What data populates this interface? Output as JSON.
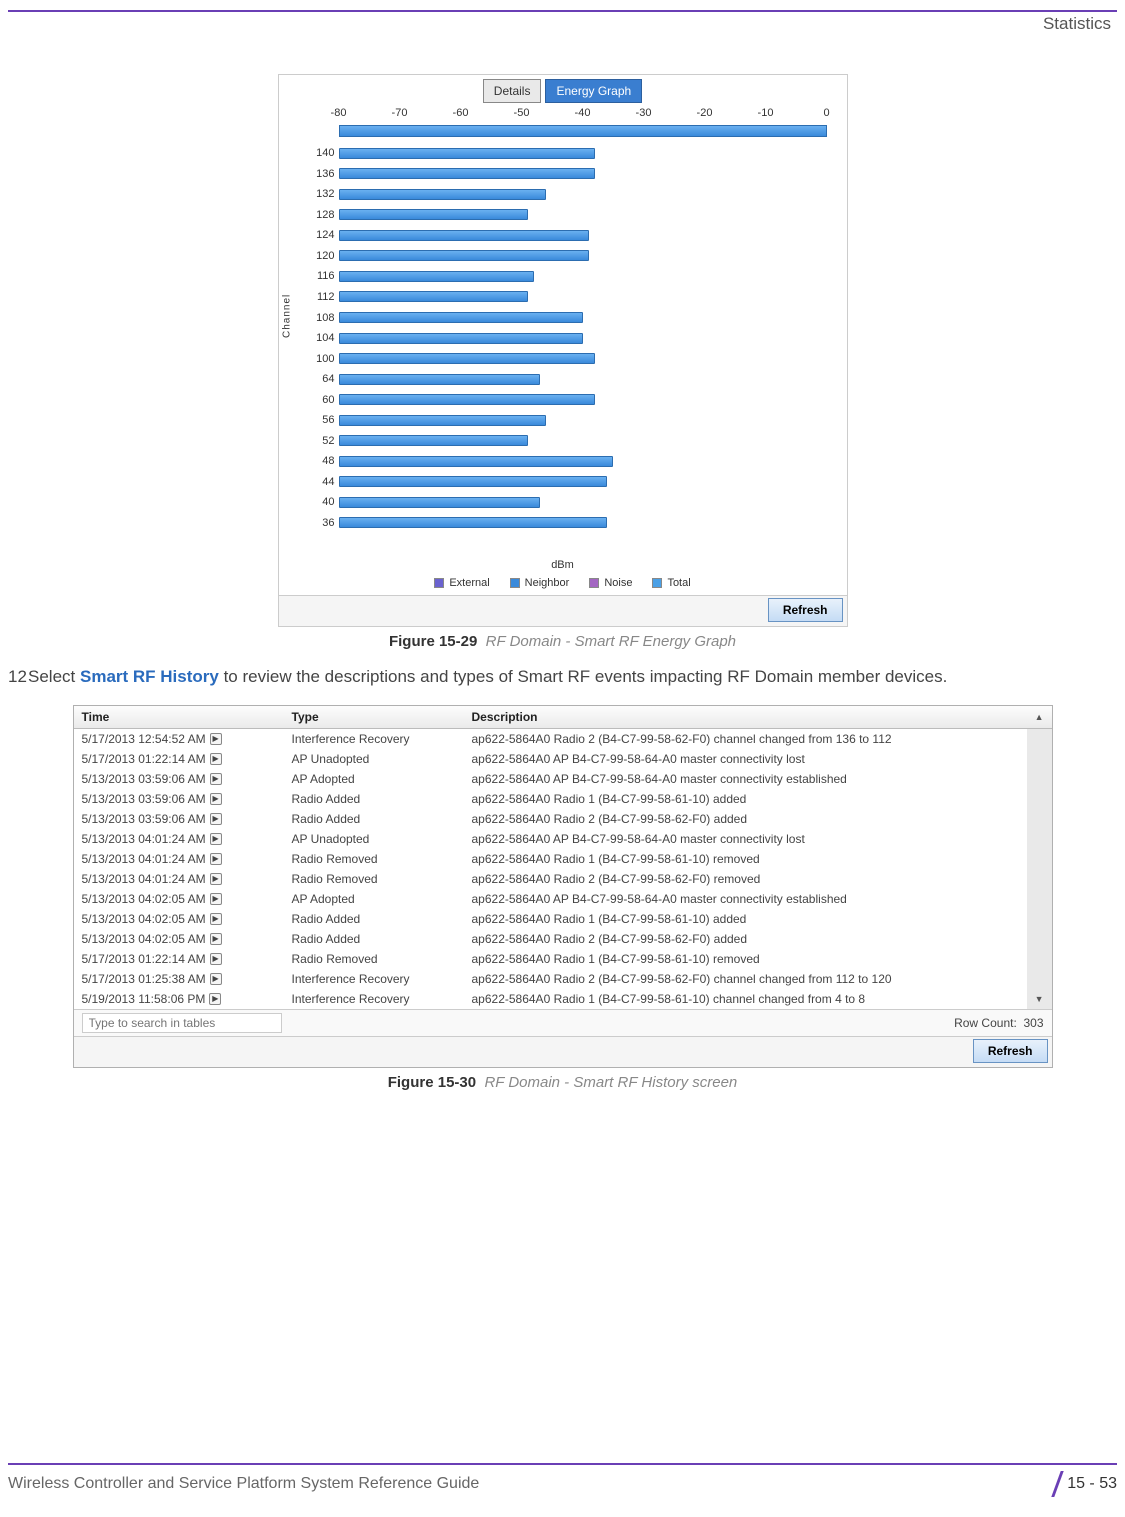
{
  "header": {
    "section": "Statistics"
  },
  "chart": {
    "tabs": {
      "details": "Details",
      "energy": "Energy Graph"
    },
    "xlabel": "dBm",
    "ylabel": "Channel",
    "legend": [
      "External",
      "Neighbor",
      "Noise",
      "Total"
    ],
    "refresh": "Refresh"
  },
  "chart_data": {
    "type": "bar",
    "title": "",
    "xlabel": "dBm",
    "ylabel": "Channel",
    "xlim": [
      -80,
      0
    ],
    "x_ticks": [
      -80,
      -70,
      -60,
      -50,
      -40,
      -30,
      -20,
      -10,
      0
    ],
    "categories": [
      "140",
      "136",
      "132",
      "128",
      "124",
      "120",
      "116",
      "112",
      "108",
      "104",
      "100",
      "64",
      "60",
      "56",
      "52",
      "48",
      "44",
      "40",
      "36"
    ],
    "values": [
      -38,
      -38,
      -46,
      -49,
      -39,
      -39,
      -48,
      -49,
      -40,
      -40,
      -38,
      -47,
      -38,
      -46,
      -49,
      -35,
      -36,
      -47,
      -36
    ],
    "legend": [
      "External",
      "Neighbor",
      "Noise",
      "Total"
    ]
  },
  "fig29": {
    "label": "Figure 15-29",
    "caption": "RF Domain - Smart RF Energy Graph"
  },
  "step": {
    "num": "12",
    "pre": "Select ",
    "bold": "Smart RF History",
    "post": " to review the descriptions and types of Smart RF events impacting RF Domain member devices."
  },
  "table": {
    "headers": {
      "time": "Time",
      "type": "Type",
      "desc": "Description"
    },
    "rows": [
      {
        "time": "5/17/2013 12:54:52 AM",
        "type": "Interference Recovery",
        "desc": "ap622-5864A0 Radio 2 (B4-C7-99-58-62-F0) channel changed from 136 to 112"
      },
      {
        "time": "5/17/2013 01:22:14 AM",
        "type": "AP Unadopted",
        "desc": "ap622-5864A0 AP B4-C7-99-58-64-A0 master connectivity lost"
      },
      {
        "time": "5/13/2013 03:59:06 AM",
        "type": "AP Adopted",
        "desc": "ap622-5864A0 AP B4-C7-99-58-64-A0 master connectivity established"
      },
      {
        "time": "5/13/2013 03:59:06 AM",
        "type": "Radio Added",
        "desc": "ap622-5864A0 Radio 1 (B4-C7-99-58-61-10) added"
      },
      {
        "time": "5/13/2013 03:59:06 AM",
        "type": "Radio Added",
        "desc": "ap622-5864A0 Radio 2 (B4-C7-99-58-62-F0) added"
      },
      {
        "time": "5/13/2013 04:01:24 AM",
        "type": "AP Unadopted",
        "desc": "ap622-5864A0 AP B4-C7-99-58-64-A0 master connectivity lost"
      },
      {
        "time": "5/13/2013 04:01:24 AM",
        "type": "Radio Removed",
        "desc": "ap622-5864A0 Radio 1 (B4-C7-99-58-61-10) removed"
      },
      {
        "time": "5/13/2013 04:01:24 AM",
        "type": "Radio Removed",
        "desc": "ap622-5864A0 Radio 2 (B4-C7-99-58-62-F0) removed"
      },
      {
        "time": "5/13/2013 04:02:05 AM",
        "type": "AP Adopted",
        "desc": "ap622-5864A0 AP B4-C7-99-58-64-A0 master connectivity established"
      },
      {
        "time": "5/13/2013 04:02:05 AM",
        "type": "Radio Added",
        "desc": "ap622-5864A0 Radio 1 (B4-C7-99-58-61-10) added"
      },
      {
        "time": "5/13/2013 04:02:05 AM",
        "type": "Radio Added",
        "desc": "ap622-5864A0 Radio 2 (B4-C7-99-58-62-F0) added"
      },
      {
        "time": "5/17/2013 01:22:14 AM",
        "type": "Radio Removed",
        "desc": "ap622-5864A0 Radio 1 (B4-C7-99-58-61-10) removed"
      },
      {
        "time": "5/17/2013 01:25:38 AM",
        "type": "Interference Recovery",
        "desc": "ap622-5864A0 Radio 2 (B4-C7-99-58-62-F0) channel changed from 112 to 120"
      },
      {
        "time": "5/19/2013 11:58:06 PM",
        "type": "Interference Recovery",
        "desc": "ap622-5864A0 Radio 1 (B4-C7-99-58-61-10) channel changed from 4 to 8"
      }
    ],
    "filter_placeholder": "Type to search in tables",
    "rowcount_label": "Row Count:",
    "rowcount": "303",
    "refresh": "Refresh"
  },
  "fig30": {
    "label": "Figure 15-30",
    "caption": "RF Domain - Smart RF History screen"
  },
  "footer": {
    "guide": "Wireless Controller and Service Platform System Reference Guide",
    "page": "15 - 53"
  }
}
